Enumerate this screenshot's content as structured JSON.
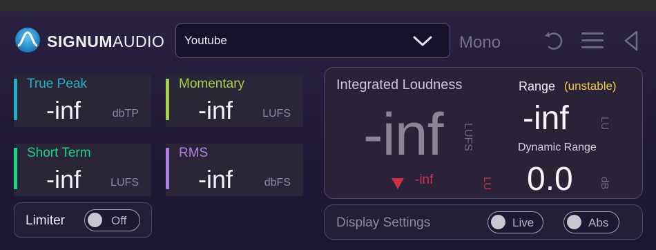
{
  "header": {
    "brand_bold": "SIGNUM",
    "brand_light": "AUDIO",
    "preset_value": "Youtube",
    "channel_mode": "Mono"
  },
  "meters": [
    {
      "label": "True Peak",
      "value": "-inf",
      "unit": "dbTP",
      "color": "#22b2c8"
    },
    {
      "label": "Momentary",
      "value": "-inf",
      "unit": "LUFS",
      "color": "#a7cf4a"
    },
    {
      "label": "Short Term",
      "value": "-inf",
      "unit": "LUFS",
      "color": "#1fd38b"
    },
    {
      "label": "RMS",
      "value": "-inf",
      "unit": "dbFS",
      "color": "#b07fe0"
    }
  ],
  "limiter": {
    "label": "Limiter",
    "toggle_label": "Off"
  },
  "integrated": {
    "title": "Integrated Loudness",
    "value": "-inf",
    "unit": "LUFS",
    "short_value": "-inf",
    "short_unit": "LU",
    "range_label": "Range",
    "range_status": "(unstable)",
    "range_value": "-inf",
    "range_unit": "LU",
    "dynamic_range_label": "Dynamic Range",
    "dynamic_range_value": "0.0",
    "dynamic_range_unit": "dB"
  },
  "display_settings": {
    "label": "Display Settings",
    "live_label": "Live",
    "abs_label": "Abs"
  },
  "icons": {
    "logo": "signum-logo-icon",
    "dropdown": "chevron-down-icon",
    "undo": "undo-icon",
    "menu": "hamburger-menu-icon",
    "collapse": "triangle-left-icon",
    "trend": "triangle-down-icon"
  },
  "colors": {
    "accent_warning": "#f3cd47",
    "trend_red": "#c8334f"
  }
}
